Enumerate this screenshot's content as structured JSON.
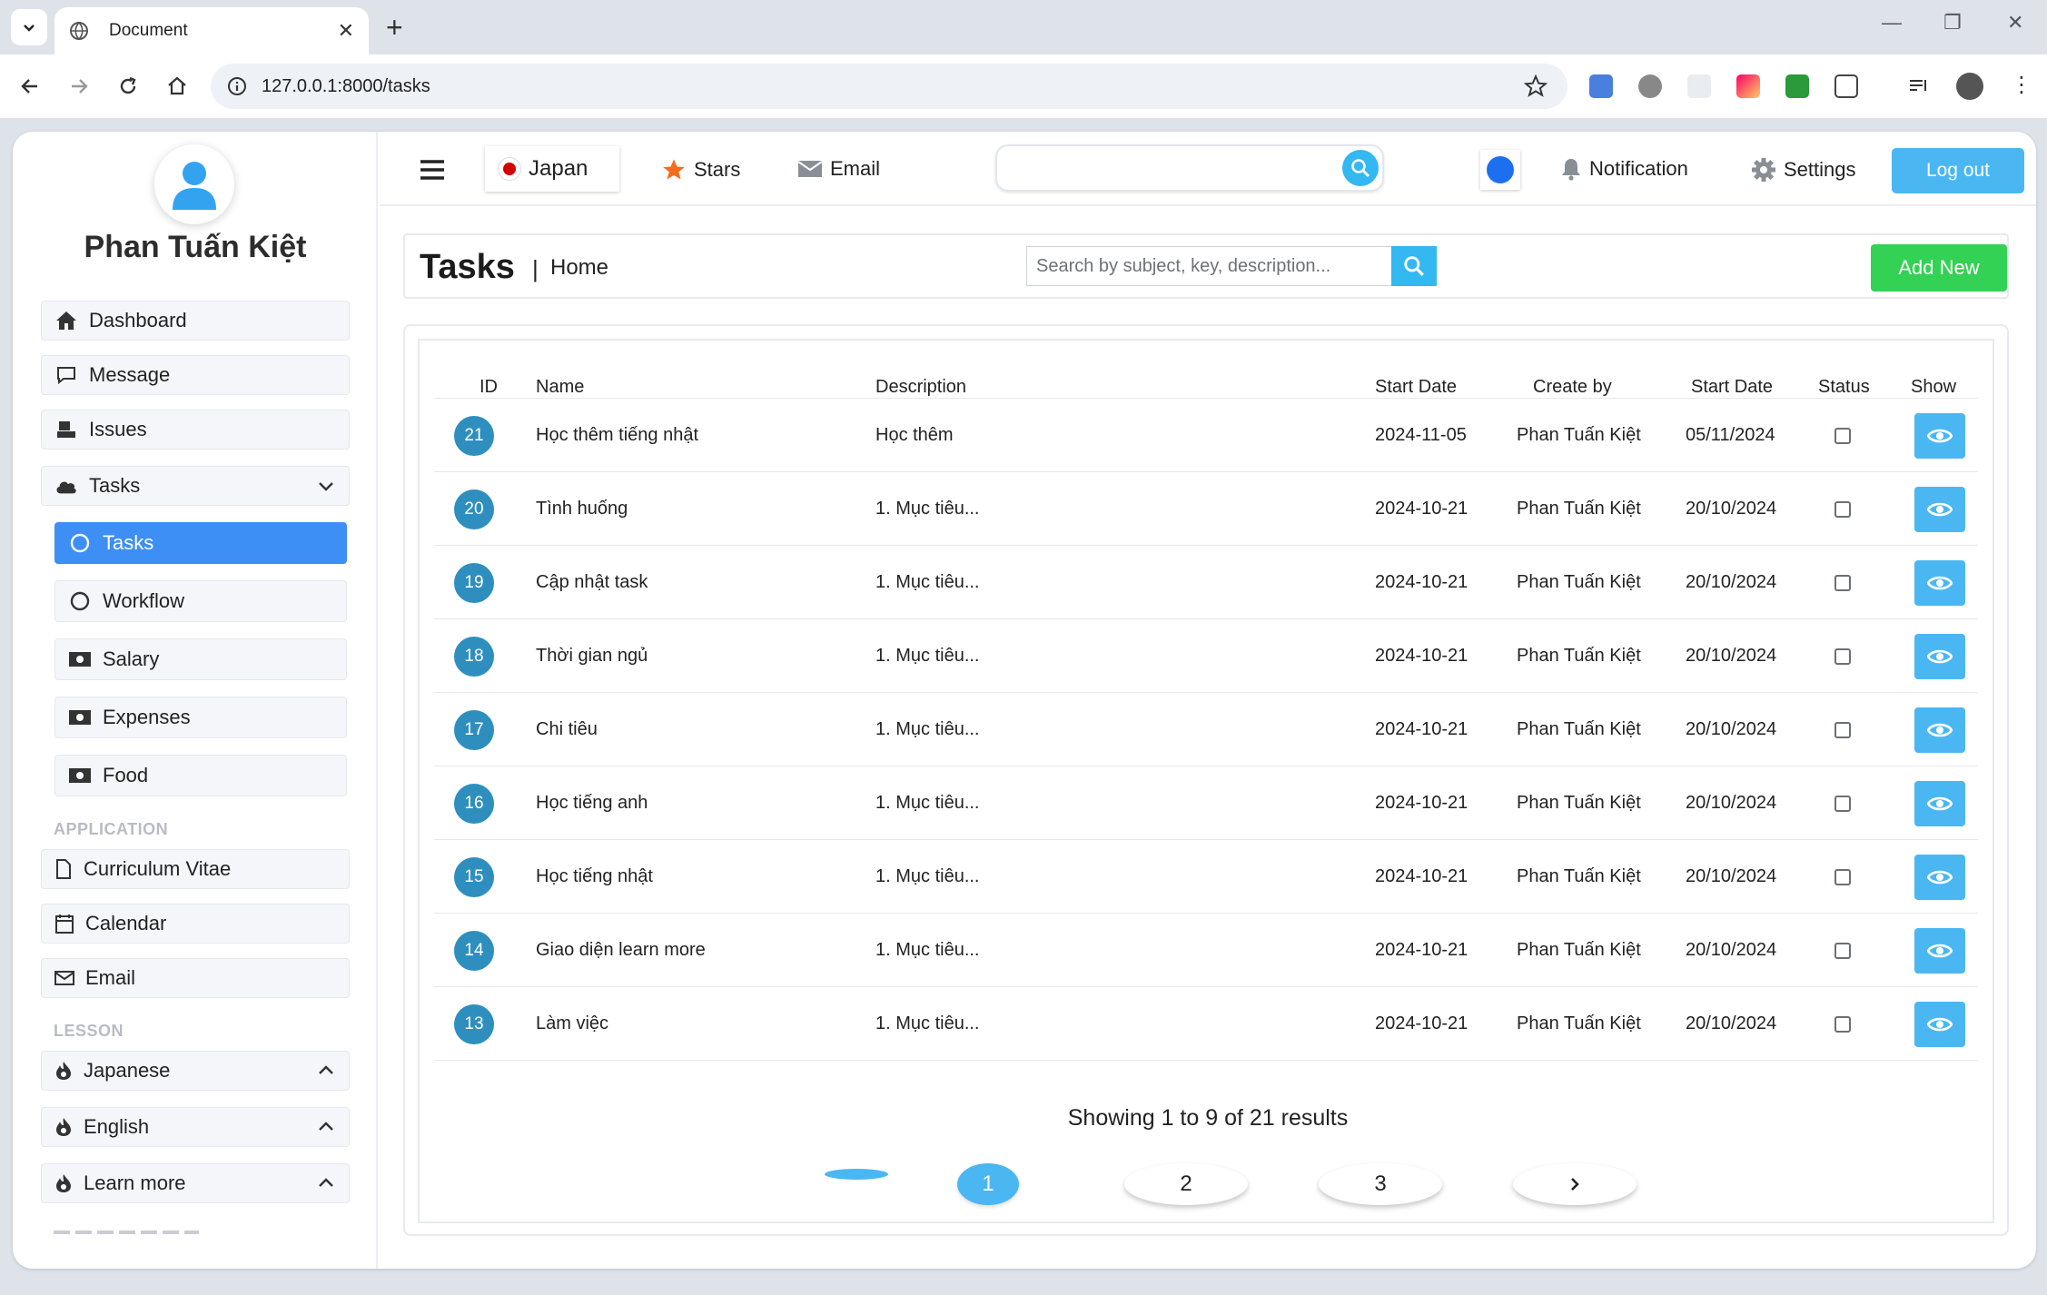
{
  "browser": {
    "tab_title": "Document",
    "url": "127.0.0.1:8000/tasks"
  },
  "sidebar": {
    "user_name": "Phan Tuấn Kiệt",
    "items": [
      {
        "label": "Dashboard"
      },
      {
        "label": "Message"
      },
      {
        "label": "Issues"
      },
      {
        "label": "Tasks"
      }
    ],
    "sub_items": [
      {
        "label": "Tasks"
      },
      {
        "label": "Workflow"
      },
      {
        "label": "Salary"
      },
      {
        "label": "Expenses"
      },
      {
        "label": "Food"
      }
    ],
    "section_application": "APPLICATION",
    "app_items": [
      {
        "label": "Curriculum Vitae"
      },
      {
        "label": "Calendar"
      },
      {
        "label": "Email"
      }
    ],
    "section_lesson": "LESSON",
    "lesson_items": [
      {
        "label": "Japanese"
      },
      {
        "label": "English"
      },
      {
        "label": "Learn more"
      }
    ]
  },
  "topbar": {
    "language": "Japan",
    "stars": "Stars",
    "email": "Email",
    "notification": "Notification",
    "settings": "Settings",
    "logout": "Log out"
  },
  "header": {
    "title": "Tasks",
    "separator": "|",
    "breadcrumb": "Home",
    "search_placeholder": "Search by subject, key, description...",
    "add_new": "Add New"
  },
  "table": {
    "columns": [
      "ID",
      "Name",
      "Description",
      "Start Date",
      "Create by",
      "Start Date",
      "Status",
      "Show"
    ],
    "rows": [
      {
        "id": "21",
        "name": "Học thêm tiếng nhật",
        "description": "Học thêm",
        "start_date": "2024-11-05",
        "created_by": "Phan Tuấn Kiệt",
        "start_date_2": "05/11/2024",
        "status": false
      },
      {
        "id": "20",
        "name": "Tình huống",
        "description": "1. Mục tiêu...",
        "start_date": "2024-10-21",
        "created_by": "Phan Tuấn Kiệt",
        "start_date_2": "20/10/2024",
        "status": false
      },
      {
        "id": "19",
        "name": "Cập nhật task",
        "description": "1. Mục tiêu...",
        "start_date": "2024-10-21",
        "created_by": "Phan Tuấn Kiệt",
        "start_date_2": "20/10/2024",
        "status": false
      },
      {
        "id": "18",
        "name": "Thời gian ngủ",
        "description": "1. Mục tiêu...",
        "start_date": "2024-10-21",
        "created_by": "Phan Tuấn Kiệt",
        "start_date_2": "20/10/2024",
        "status": false
      },
      {
        "id": "17",
        "name": "Chi tiêu",
        "description": "1. Mục tiêu...",
        "start_date": "2024-10-21",
        "created_by": "Phan Tuấn Kiệt",
        "start_date_2": "20/10/2024",
        "status": false
      },
      {
        "id": "16",
        "name": "Học tiếng anh",
        "description": "1. Mục tiêu...",
        "start_date": "2024-10-21",
        "created_by": "Phan Tuấn Kiệt",
        "start_date_2": "20/10/2024",
        "status": false
      },
      {
        "id": "15",
        "name": "Học tiếng nhật",
        "description": "1. Mục tiêu...",
        "start_date": "2024-10-21",
        "created_by": "Phan Tuấn Kiệt",
        "start_date_2": "20/10/2024",
        "status": false
      },
      {
        "id": "14",
        "name": "Giao diện learn more",
        "description": "1. Mục tiêu...",
        "start_date": "2024-10-21",
        "created_by": "Phan Tuấn Kiệt",
        "start_date_2": "20/10/2024",
        "status": false
      },
      {
        "id": "13",
        "name": "Làm việc",
        "description": "1. Mục tiêu...",
        "start_date": "2024-10-21",
        "created_by": "Phan Tuấn Kiệt",
        "start_date_2": "20/10/2024",
        "status": false
      }
    ]
  },
  "pagination": {
    "summary": "Showing 1 to 9 of 21 results",
    "pages": [
      "1",
      "2",
      "3"
    ],
    "current": "1",
    "next_icon": "chevron-right-icon"
  },
  "colors": {
    "accent_blue": "#4ab7f2",
    "active_nav": "#3d8ef5",
    "add_new_green": "#33d154",
    "id_badge": "#2e8fbf"
  }
}
